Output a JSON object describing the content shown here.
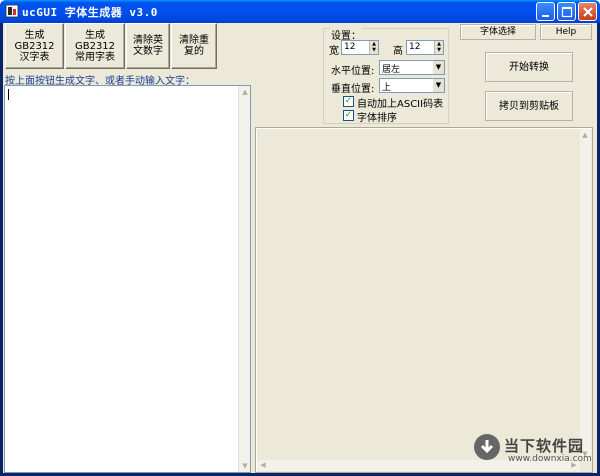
{
  "window": {
    "title": "ucGUI 字体生成器 v3.0",
    "icons": {
      "app": "app-icon",
      "minimize": "minimize-icon",
      "maximize": "maximize-icon",
      "close": "close-icon"
    }
  },
  "toolbar": {
    "gen_gb2312_chars": "生成GB2312\n汉字表",
    "gen_gb2312_common": "生成GB2312\n常用字表",
    "clear_alnum": "清除英\n文数字",
    "clear_duplicates": "清除重\n复的"
  },
  "hint": "按上面按钮生成文字、或者手动输入文字：",
  "editor": {
    "value": ""
  },
  "settings": {
    "group_label": "设置：",
    "width_label": "宽",
    "width_value": "12",
    "height_label": "高",
    "height_value": "12",
    "h_align_label": "水平位置:",
    "h_align_value": "居左",
    "v_align_label": "垂直位置:",
    "v_align_value": "上",
    "auto_ascii_label": "自动加上ASCII码表",
    "auto_ascii_checked": true,
    "sort_label": "字体排序",
    "sort_checked": true
  },
  "actions": {
    "font_select": "字体选择",
    "help": "Help",
    "start_convert": "开始转换",
    "copy_clipboard": "拷贝到剪贴板"
  },
  "watermark": {
    "brand": "当下软件园",
    "url": "www.downxia.com"
  },
  "colors": {
    "titlebar": "#0053ee",
    "face": "#ece9d8",
    "hint_text": "#1c3f9a",
    "close_button": "#c73e1c"
  }
}
